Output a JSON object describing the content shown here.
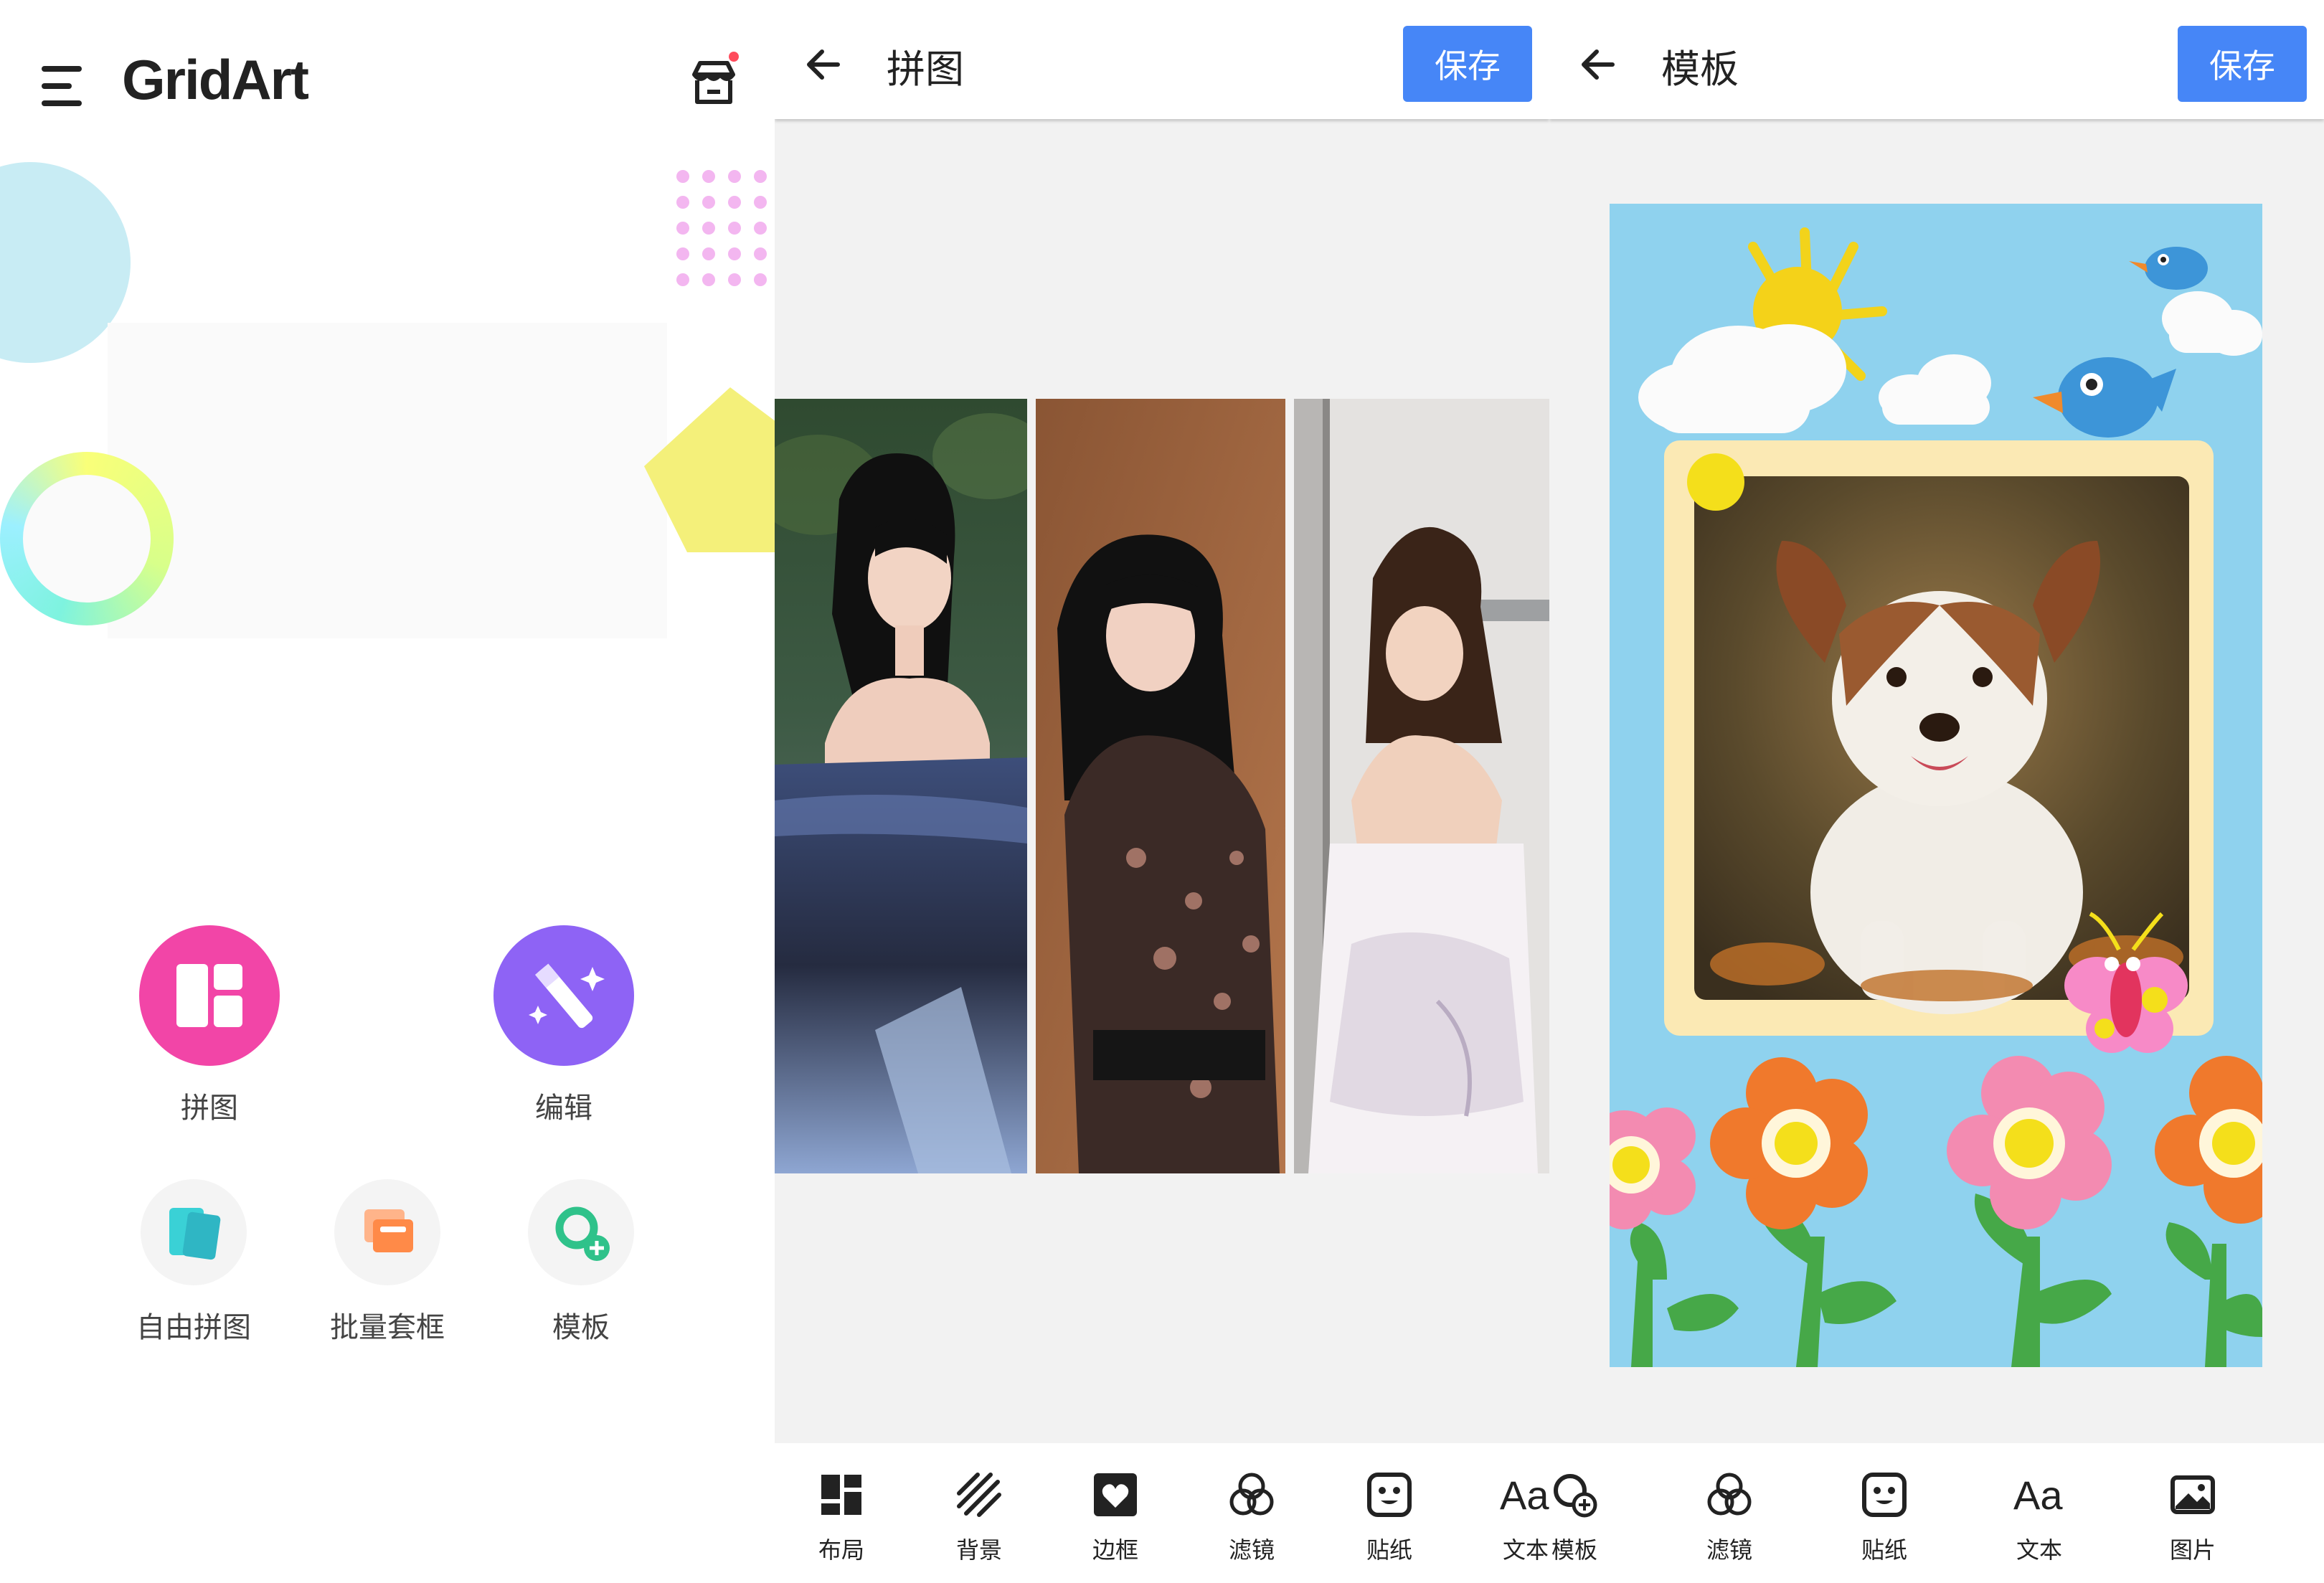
{
  "home": {
    "brand": "GridArt",
    "tools": {
      "collage": "拼图",
      "edit": "编辑",
      "free_collage": "自由拼图",
      "batch_frame": "批量套框",
      "template": "模板"
    },
    "colors": {
      "collage": "#f245a7",
      "edit": "#8e63f5",
      "free": "#3ad1d6",
      "batch": "#ff8a48",
      "template": "#2fc28a"
    }
  },
  "collage": {
    "title": "拼图",
    "save_label": "保存",
    "toolbar": [
      "布局",
      "背景",
      "边框",
      "滤镜",
      "贴纸",
      "文本"
    ]
  },
  "template": {
    "title": "模板",
    "save_label": "保存",
    "toolbar": [
      "模板",
      "滤镜",
      "贴纸",
      "文本",
      "图片"
    ]
  },
  "icons": {
    "menu": "menu-icon",
    "store": "store-icon",
    "back": "back-arrow-icon",
    "layout": "layout-icon",
    "background": "background-icon",
    "border": "heart-frame-icon",
    "filter": "filter-icon",
    "sticker": "sticker-icon",
    "text": "text-icon",
    "template": "template-icon",
    "image": "image-icon"
  },
  "accent": "#4686f7"
}
